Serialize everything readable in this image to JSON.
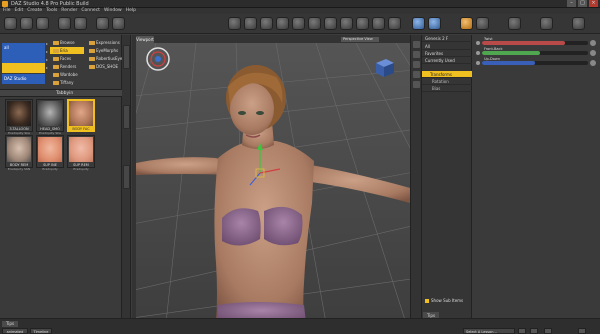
{
  "window": {
    "title": "DAZ Studio 4.8 Pro Public Build"
  },
  "menu": [
    "File",
    "Edit",
    "Create",
    "Tools",
    "Render",
    "Connect",
    "Window",
    "Help"
  ],
  "left_panel": {
    "top_rows": [
      "all",
      "",
      "",
      "DAZ Studio"
    ],
    "folders_col1": [
      "Browse",
      "Eria",
      "Faces",
      "Renders",
      "Wardobe",
      "Tiffany"
    ],
    "folders_col2": [
      "Expressions",
      "EyeMorphs",
      "RobertiusEye",
      "DOS_SHOE"
    ],
    "library_title": "Tabbyin",
    "thumbnails": [
      {
        "label": "3-TALLOON",
        "sub": "Eradiquity Ska"
      },
      {
        "label": "HEAD_SMO",
        "sub": "Eradiquity Ska"
      },
      {
        "label": "BODY FAC",
        "sub": "Eradiquity Ska"
      },
      {
        "label": "BODY REM",
        "sub": "Eradiquity SKN"
      },
      {
        "label": "SUP INE",
        "sub": "Eradiquity"
      },
      {
        "label": "SUP REM",
        "sub": "Eradiquity"
      }
    ]
  },
  "viewport": {
    "tab_label": "Viewport",
    "view_selector": "Perspective View"
  },
  "right_panel": {
    "tree_header": "Genesis 2 F",
    "tree_items": [
      "All",
      "Favorites",
      "Currently Used"
    ],
    "tree_selected": "Transforms",
    "tree_children": [
      "Rotation",
      "Bias"
    ],
    "params": [
      {
        "name": "Twist",
        "value": 0.78,
        "color": "#b84a4a"
      },
      {
        "name": "Front-Back",
        "value": 0.55,
        "color": "#4fa84f"
      },
      {
        "name": "Up-Down",
        "value": 0.5,
        "color": "#3a5fb8"
      }
    ],
    "show_sub_items": "Show Sub Items"
  },
  "bottom": {
    "tips_left": "Tips",
    "tips_right": "Tips",
    "tabs": [
      "animated",
      "Timeline"
    ],
    "lesson_selector": "Select A Lesson..."
  }
}
